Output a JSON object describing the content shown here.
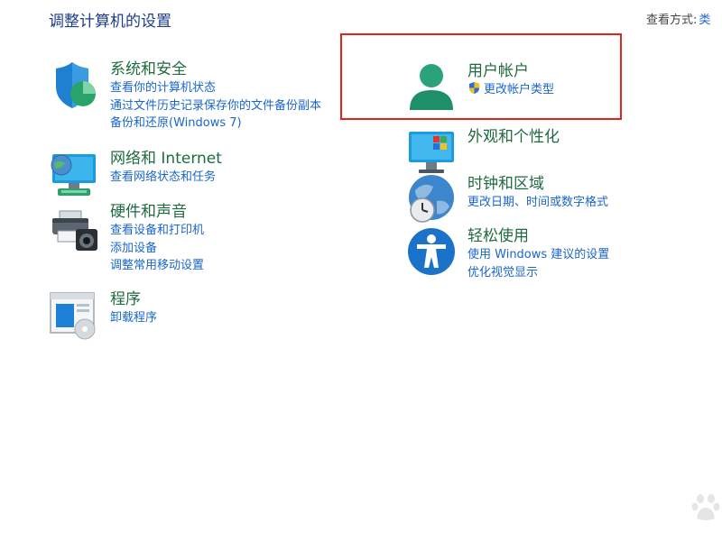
{
  "header": {
    "title": "调整计算机的设置",
    "view_by_label": "查看方式:",
    "view_by_value": "类"
  },
  "left_categories": [
    {
      "title": "系统和安全",
      "icon": "shield-icon",
      "links": [
        "查看你的计算机状态",
        "通过文件历史记录保存你的文件备份副本",
        "备份和还原(Windows 7)"
      ]
    },
    {
      "title": "网络和 Internet",
      "icon": "network-icon",
      "links": [
        "查看网络状态和任务"
      ]
    },
    {
      "title": "硬件和声音",
      "icon": "printer-icon",
      "links": [
        "查看设备和打印机",
        "添加设备",
        "调整常用移动设置"
      ]
    },
    {
      "title": "程序",
      "icon": "programs-icon",
      "links": [
        "卸载程序"
      ]
    }
  ],
  "right_categories": [
    {
      "title": "用户帐户",
      "icon": "user-icon",
      "links": [
        "更改帐户类型"
      ]
    },
    {
      "title": "外观和个性化",
      "icon": "monitor-icon",
      "links": []
    },
    {
      "title": "时钟和区域",
      "icon": "clock-globe-icon",
      "links": [
        "更改日期、时间或数字格式"
      ]
    },
    {
      "title": "轻松使用",
      "icon": "accessibility-icon",
      "links": [
        "使用 Windows 建议的设置",
        "优化视觉显示"
      ]
    }
  ],
  "colors": {
    "title_blue": "#1e3c8c",
    "category_green": "#1f6b3f",
    "link_blue": "#1a66cc",
    "highlight_red": "#e1251b"
  }
}
